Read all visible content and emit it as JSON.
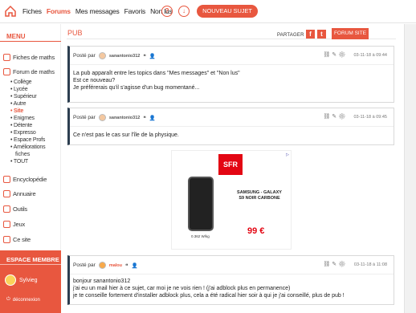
{
  "topbar": {
    "nav": [
      "Fiches",
      "Forums",
      "Mes messages",
      "Favoris",
      "Non lus"
    ],
    "active_nav": "Forums",
    "new_topic_label": "NOUVEAU SUJET"
  },
  "sidebar": {
    "title": "MENU",
    "items": [
      {
        "label": "Fiches de maths",
        "icon": "document-icon"
      },
      {
        "label": "Forum de maths",
        "icon": "forum-icon"
      },
      {
        "label": "Encyclopédie",
        "icon": "book-icon"
      },
      {
        "label": "Annuaire",
        "icon": "directory-icon"
      },
      {
        "label": "Outils",
        "icon": "tools-icon"
      },
      {
        "label": "Jeux",
        "icon": "games-icon"
      },
      {
        "label": "Ce site",
        "icon": "site-icon"
      }
    ],
    "forum_sub": [
      "Collège",
      "Lycée",
      "Supérieur",
      "Autre",
      "Site",
      "Enigmes",
      "Détente",
      "Expresso",
      "Espace Profs",
      "Améliorations",
      "fiches",
      "TOUT"
    ],
    "active_sub": "Site",
    "espace": {
      "title": "ESPACE MEMBRE",
      "user": "Sylvieg",
      "logout": "déconnexion"
    }
  },
  "main": {
    "title": "PUB",
    "share_label": "PARTAGER :",
    "forum_site_label": "FORUM SITE",
    "posts": [
      {
        "posted_by": "Posté par",
        "author": "sanantonio312",
        "date": "03-11-18 à 09:44",
        "lines": [
          "La pub apparaît entre les topics dans \"Mes messages\" et \"Non lus\"",
          "Est ce nouveau?",
          "Je préférerais qu'il s'agisse d'un bug momentané..."
        ]
      },
      {
        "posted_by": "Posté par",
        "author": "sanantonio312",
        "date": "03-11-18 à 09:45",
        "lines": [
          "Ce n'est pas le cas sur l'île de la physique."
        ]
      },
      {
        "posted_by": "Posté par",
        "author": "malou",
        "date": "03-11-18 à 11:08",
        "lines": [
          "bonjour sanantonio312",
          "j'ai eu un mail hier à ce sujet, car moi je ne vois rien ! (j'ai adblock plus en permanence)",
          "je te conseille fortement d'installer adblock plus, cela a été radical hier soir à qui je j'ai conseillé, plus de pub !"
        ]
      }
    ],
    "ad": {
      "brand": "SFR",
      "product_line1": "SAMSUNG - GALAXY",
      "product_line2": "S9 NOIR CARBONE",
      "price": "99 €",
      "small": "0.362 W/kg",
      "colors": {
        "brand": "#e30613"
      }
    }
  },
  "colors": {
    "accent": "#e8573f",
    "post_border": "#2c3e50"
  }
}
